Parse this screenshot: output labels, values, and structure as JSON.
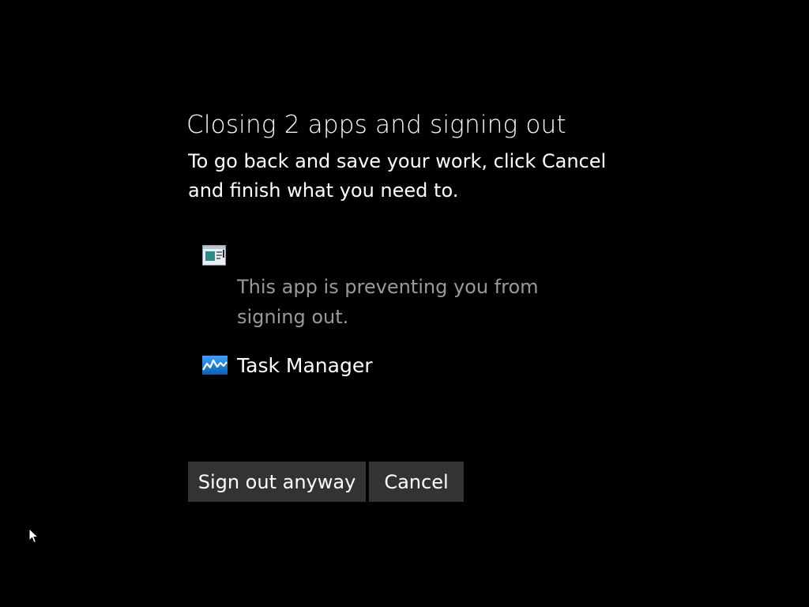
{
  "dialog": {
    "title": "Closing 2 apps and signing out",
    "subtitle": "To go back and save your work, click Cancel and finish what you need to."
  },
  "apps": [
    {
      "icon": "generic-app-window-icon",
      "name": "",
      "note": "This app is preventing you from signing out."
    },
    {
      "icon": "task-manager-icon",
      "name": "Task Manager"
    }
  ],
  "buttons": {
    "sign_out_anyway": "Sign out anyway",
    "cancel": "Cancel"
  },
  "colors": {
    "background": "#000000",
    "text": "#ffffff",
    "muted_text": "#9a9a9a",
    "button_bg": "#333333",
    "task_manager_icon_blue": "#1e90ff"
  }
}
